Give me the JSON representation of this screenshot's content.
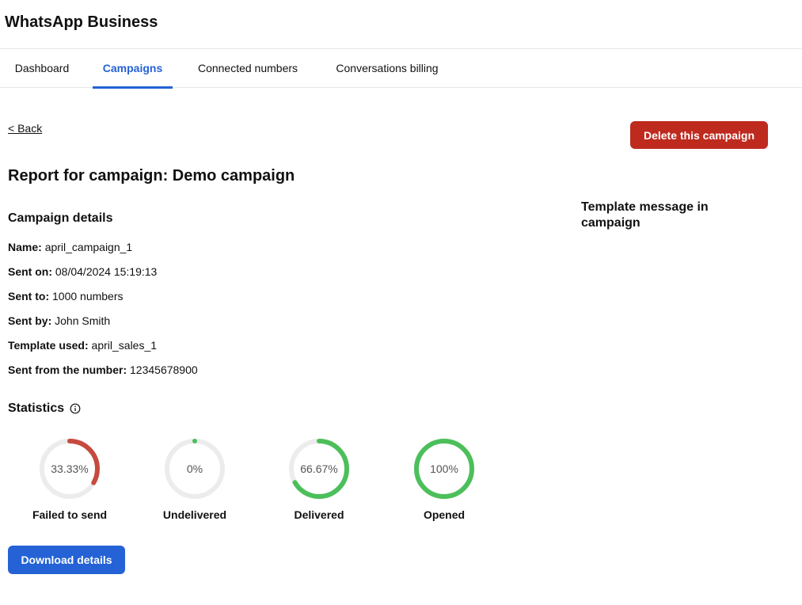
{
  "app": {
    "title": "WhatsApp Business"
  },
  "tabs": [
    {
      "label": "Dashboard",
      "active": false
    },
    {
      "label": "Campaigns",
      "active": true
    },
    {
      "label": "Connected numbers",
      "active": false
    },
    {
      "label": "Conversations billing",
      "active": false
    }
  ],
  "back_label": "< Back",
  "delete_label": "Delete this campaign",
  "report_title": "Report for campaign: Demo campaign",
  "details": {
    "heading": "Campaign details",
    "rows": [
      {
        "label": "Name:",
        "value": "april_campaign_1"
      },
      {
        "label": "Sent on:",
        "value": "08/04/2024 15:19:13"
      },
      {
        "label": "Sent to:",
        "value": "1000 numbers"
      },
      {
        "label": "Sent by:",
        "value": "John Smith"
      },
      {
        "label": "Template used:",
        "value": "april_sales_1"
      },
      {
        "label": "Sent from the number:",
        "value": "12345678900"
      }
    ]
  },
  "template_heading": "Template message in campaign",
  "statistics": {
    "heading": "Statistics",
    "info_icon": "info-icon",
    "items": [
      {
        "name": "Failed to send",
        "label": "33.33%",
        "fraction": 0.3333,
        "color": "#c64a3f"
      },
      {
        "name": "Undelivered",
        "label": "0%",
        "fraction": 0.0,
        "color": "#4cbf5a"
      },
      {
        "name": "Delivered",
        "label": "66.67%",
        "fraction": 0.6667,
        "color": "#4cbf5a"
      },
      {
        "name": "Opened",
        "label": "100%",
        "fraction": 1.0,
        "color": "#4cbf5a"
      }
    ],
    "track_color": "#ececec"
  },
  "download_label": "Download details",
  "colors": {
    "accent": "#2462d6",
    "danger": "#bf2a1f"
  }
}
